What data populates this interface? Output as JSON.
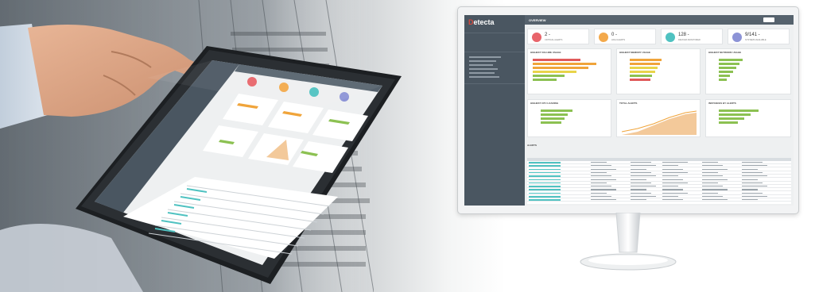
{
  "brand": {
    "name_prefix": "",
    "name_x": "D",
    "name": "etecta"
  },
  "colors": {
    "kpi1": "#e8646a",
    "kpi2": "#f3a94b",
    "kpi3": "#4fc2c1",
    "kpi4": "#8c93d6",
    "bar_orange": "#f0a43a",
    "bar_yellow": "#e8d44a",
    "bar_green": "#8cc152",
    "bar_red": "#e05a5a",
    "area": "#f3c99a"
  },
  "kpis": [
    {
      "value": "2 -",
      "label": "CRITICAL ALERTS"
    },
    {
      "value": "0 -",
      "label": "HIGH ALERTS"
    },
    {
      "value": "128 -",
      "label": "DEVICES MONITORED"
    },
    {
      "value": "9/141 -",
      "label": "SYSTEMS AVAILABLE"
    }
  ],
  "panels": [
    "HIGHEST VOLUME USAGE",
    "HIGHEST MEMORY USAGE",
    "HIGHEST NETWORK USAGE",
    "HIGHEST CPU LOADING",
    "TOTAL ALERTS",
    "INSTANCES BY ALERTS"
  ],
  "section_alerts": "ALERTS",
  "top_title": "OVERVIEW"
}
